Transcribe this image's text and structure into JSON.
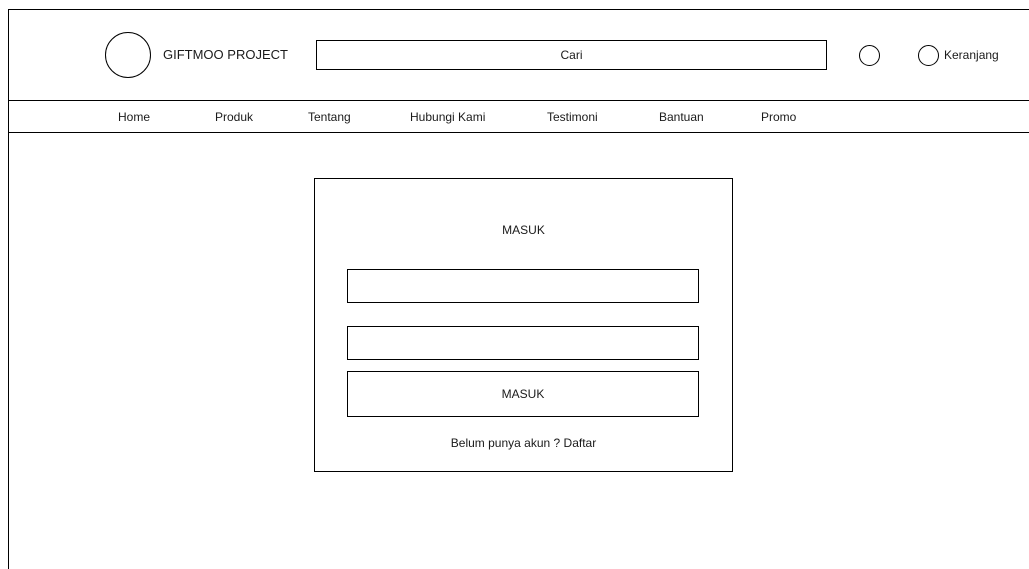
{
  "header": {
    "brand": "GIFTMOO PROJECT",
    "search_placeholder": "Cari",
    "cart_label": "Keranjang"
  },
  "nav": {
    "items": [
      "Home",
      "Produk",
      "Tentang",
      "Hubungi Kami",
      "Testimoni",
      "Bantuan",
      "Promo"
    ]
  },
  "login": {
    "title": "MASUK",
    "username_value": "",
    "password_value": "",
    "button_label": "MASUK",
    "signup_text": "Belum punya akun ? Daftar"
  },
  "icons": {
    "logo": "logo-circle-icon",
    "account": "account-circle-icon",
    "cart": "cart-circle-icon"
  },
  "colors": {
    "border": "#000000",
    "background": "#ffffff",
    "text": "#1a1a1a"
  }
}
